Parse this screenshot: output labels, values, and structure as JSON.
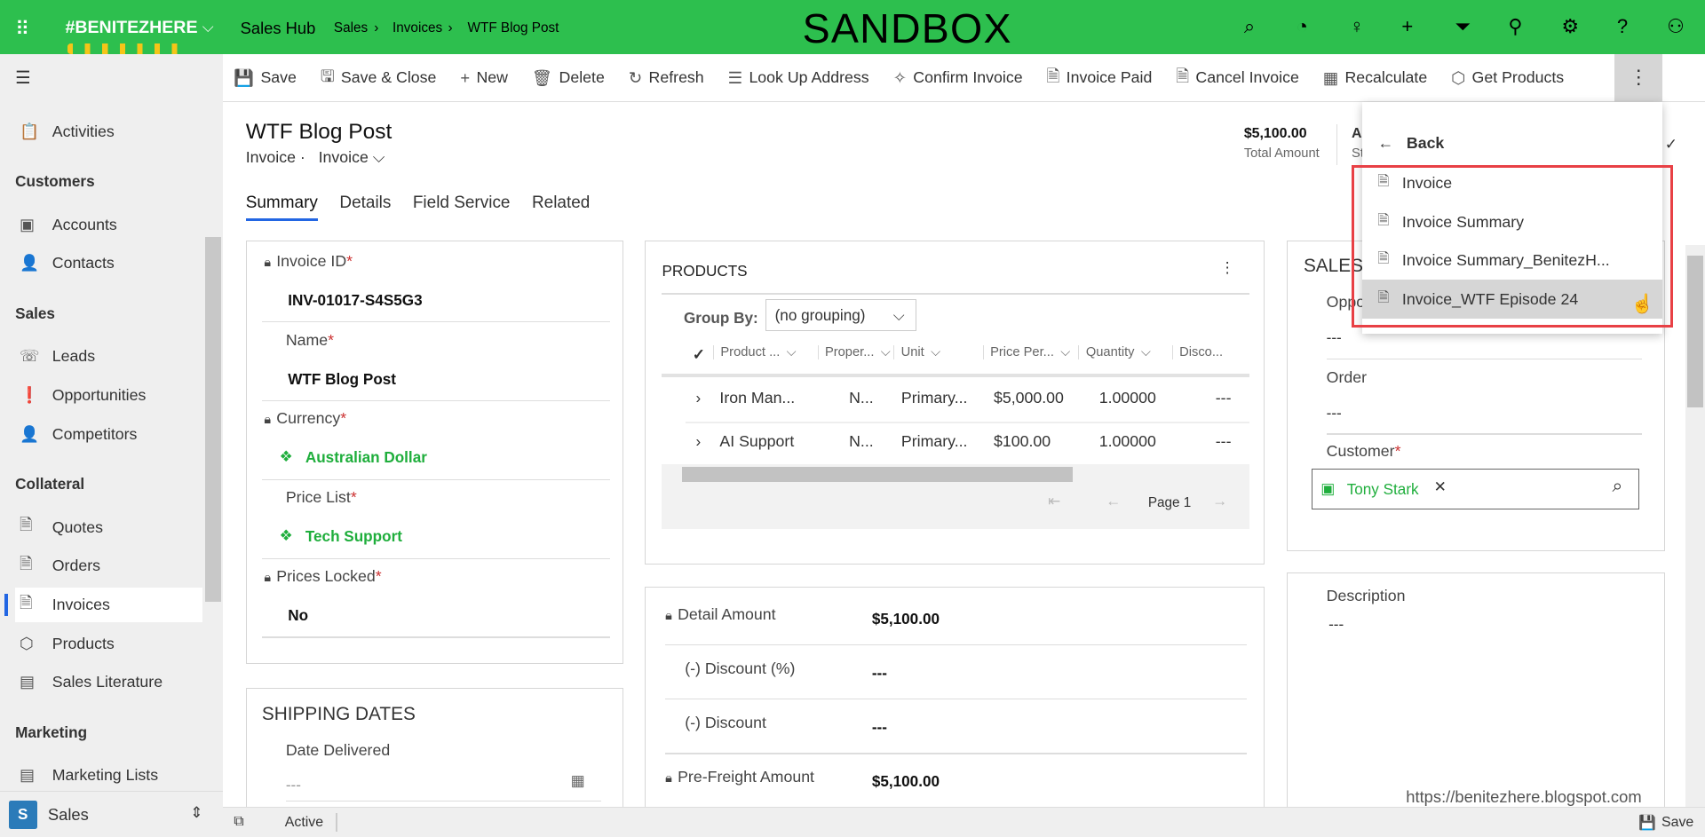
{
  "topbar": {
    "brand": "#BENITEZHERE",
    "app": "Sales Hub",
    "breadcrumb": [
      "Sales",
      "Invoices",
      "WTF Blog Post"
    ],
    "environment": "SANDBOX",
    "icons": [
      "search-icon",
      "task-icon",
      "lightbulb-icon",
      "plus-icon",
      "filter-icon",
      "assistant-icon",
      "gear-icon",
      "help-icon",
      "user-icon"
    ],
    "color": "#2dbf4e"
  },
  "commands": [
    {
      "label": "Save",
      "icon": "💾"
    },
    {
      "label": "Save & Close",
      "icon": "🖫"
    },
    {
      "label": "New",
      "icon": "+"
    },
    {
      "label": "Delete",
      "icon": "🗑"
    },
    {
      "label": "Refresh",
      "icon": "↻"
    },
    {
      "label": "Look Up Address",
      "icon": "☰"
    },
    {
      "label": "Confirm Invoice",
      "icon": "✧"
    },
    {
      "label": "Invoice Paid",
      "icon": "🗎"
    },
    {
      "label": "Cancel Invoice",
      "icon": "🗎"
    },
    {
      "label": "Recalculate",
      "icon": "▦"
    },
    {
      "label": "Get Products",
      "icon": "⬡"
    }
  ],
  "nav": {
    "items": [
      {
        "type": "item",
        "label": "Activities",
        "icon": "📋"
      },
      {
        "type": "header",
        "label": "Customers"
      },
      {
        "type": "item",
        "label": "Accounts",
        "icon": "▣"
      },
      {
        "type": "item",
        "label": "Contacts",
        "icon": "👤"
      },
      {
        "type": "header",
        "label": "Sales"
      },
      {
        "type": "item",
        "label": "Leads",
        "icon": "☏"
      },
      {
        "type": "item",
        "label": "Opportunities",
        "icon": "❗"
      },
      {
        "type": "item",
        "label": "Competitors",
        "icon": "👤"
      },
      {
        "type": "header",
        "label": "Collateral"
      },
      {
        "type": "item",
        "label": "Quotes",
        "icon": "🗎"
      },
      {
        "type": "item",
        "label": "Orders",
        "icon": "🗎"
      },
      {
        "type": "item",
        "label": "Invoices",
        "icon": "🗎",
        "selected": true
      },
      {
        "type": "item",
        "label": "Products",
        "icon": "⬡"
      },
      {
        "type": "item",
        "label": "Sales Literature",
        "icon": "▤"
      },
      {
        "type": "header",
        "label": "Marketing"
      },
      {
        "type": "item",
        "label": "Marketing Lists",
        "icon": "▤"
      }
    ],
    "area": {
      "badge": "S",
      "label": "Sales"
    }
  },
  "header": {
    "title": "WTF Blog Post",
    "entity": "Invoice",
    "form": "Invoice",
    "total_amount": "$5,100.00",
    "total_amount_label": "Total Amount",
    "status_partial": "A",
    "status_label_partial": "St"
  },
  "tabs": [
    "Summary",
    "Details",
    "Field Service",
    "Related"
  ],
  "summary": {
    "fields": [
      {
        "label": "Invoice ID",
        "value": "INV-01017-S4S5G3",
        "locked": true
      },
      {
        "label": "Name",
        "value": "WTF Blog Post",
        "locked": false
      },
      {
        "label": "Currency",
        "value": "Australian Dollar",
        "locked": true,
        "link": true
      },
      {
        "label": "Price List",
        "value": "Tech Support",
        "locked": false,
        "link": true
      },
      {
        "label": "Prices Locked",
        "value": "No",
        "locked": true
      }
    ]
  },
  "shipping": {
    "title": "SHIPPING DATES",
    "date_delivered_label": "Date Delivered",
    "date_delivered_value": "---"
  },
  "products": {
    "title": "PRODUCTS",
    "group_by_label": "Group By:",
    "group_by_value": "(no grouping)",
    "columns": [
      "Product ...",
      "Proper...",
      "Unit",
      "Price Per...",
      "Quantity",
      "Disco..."
    ],
    "rows": [
      [
        "Iron Man...",
        "N...",
        "Primary...",
        "$5,000.00",
        "1.00000",
        "---"
      ],
      [
        "AI Support",
        "N...",
        "Primary...",
        "$100.00",
        "1.00000",
        "---"
      ]
    ],
    "page": "Page 1"
  },
  "totals": [
    {
      "label": "Detail Amount",
      "value": "$5,100.00",
      "locked": true
    },
    {
      "label": "(-) Discount (%)",
      "value": "---"
    },
    {
      "label": "(-) Discount",
      "value": "---"
    },
    {
      "label": "Pre-Freight Amount",
      "value": "$5,100.00",
      "locked": true
    }
  ],
  "sales": {
    "title_partial": "SALES I",
    "opportunity_partial": "Oppo",
    "opportunity_value": "---",
    "order_label": "Order",
    "order_value": "---",
    "customer_label": "Customer",
    "customer_value": "Tony Stark"
  },
  "description": {
    "label": "Description",
    "value": "---"
  },
  "menu": {
    "back": "Back",
    "items": [
      "Invoice",
      "Invoice Summary",
      "Invoice Summary_BenitezH...",
      "Invoice_WTF Episode 24"
    ],
    "hovered_index": 3
  },
  "status_bar": {
    "state": "Active",
    "save": "Save"
  },
  "watermark": "https://benitezhere.blogspot.com"
}
